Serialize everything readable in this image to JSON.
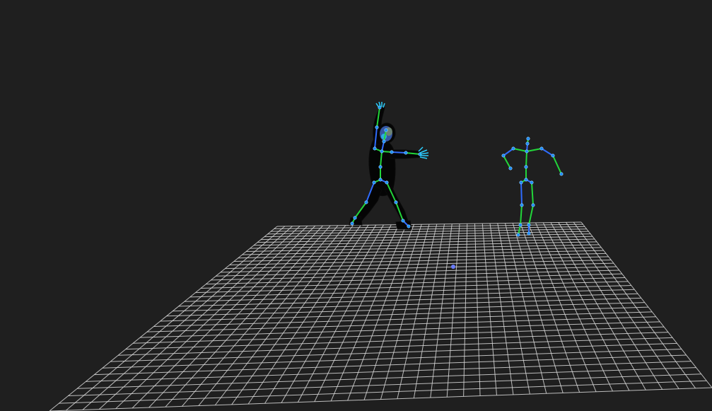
{
  "viewport": {
    "background": "#1f1f1f",
    "grid_color": "#d8d8d8",
    "grid_divisions": 40,
    "bone_color": "#22d63a",
    "bone_secondary_color": "#2f6cff",
    "joint_color": "#1a8cff",
    "body_color": "#050505"
  },
  "scene": {
    "floor": {
      "name": "floor-grid"
    },
    "origin_marker": {
      "name": "origin-marker",
      "color": "#6a7cff"
    },
    "characters": [
      {
        "name": "mesh-character",
        "has_body_mesh": true
      },
      {
        "name": "reference-skeleton",
        "has_body_mesh": false
      }
    ]
  }
}
